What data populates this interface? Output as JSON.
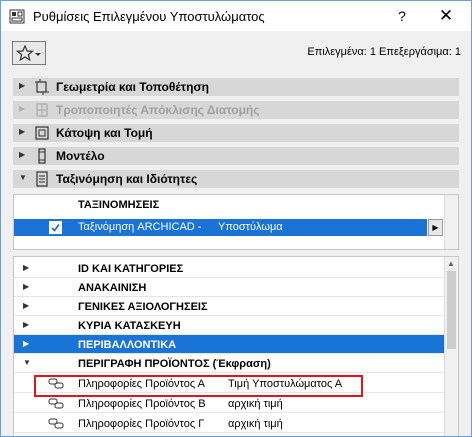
{
  "window": {
    "title": "Ρυθμίσεις Επιλεγμένου Υποστυλώματος",
    "help_label": "?",
    "close_label": "✕"
  },
  "toolbar": {
    "favorites_icon": "star-icon",
    "status_text": "Επιλεγμένα: 1 Επεξεργάσιμα: 1"
  },
  "panels": [
    {
      "label": "Γεωμετρία και Τοποθέτηση",
      "icon": "geometry-icon",
      "enabled": true,
      "expanded": false
    },
    {
      "label": "Τροποποιητές Απόκλισης Διατομής",
      "icon": "profile-modifier-icon",
      "enabled": false,
      "expanded": false
    },
    {
      "label": "Κάτοψη και Τομή",
      "icon": "floorplan-icon",
      "enabled": true,
      "expanded": false
    },
    {
      "label": "Μοντέλο",
      "icon": "model-icon",
      "enabled": true,
      "expanded": false
    },
    {
      "label": "Ταξινόμηση και Ιδιότητες",
      "icon": "classification-icon",
      "enabled": true,
      "expanded": true
    }
  ],
  "classifications": {
    "header": "ΤΑΞΙΝΟΜΗΣΕΙΣ",
    "row": {
      "system": "Ταξινόμηση ARCHICAD -",
      "value": "Υποστύλωμα",
      "checked": true
    }
  },
  "property_groups": [
    {
      "label": "ID ΚΑΙ ΚΑΤΗΓΟΡΙΕΣ",
      "expanded": false,
      "selected": false
    },
    {
      "label": "ΑΝΑΚΑΙΝΙΣΗ",
      "expanded": false,
      "selected": false
    },
    {
      "label": "ΓΕΝΙΚΕΣ ΑΞΙΟΛΟΓΗΣΕΙΣ",
      "expanded": false,
      "selected": false
    },
    {
      "label": "ΚΥΡΙΑ ΚΑΤΑΣΚΕΥΗ",
      "expanded": false,
      "selected": false
    },
    {
      "label": "ΠΕΡΙΒΑΛΛΟΝΤΙΚΑ",
      "expanded": false,
      "selected": true
    },
    {
      "label": "ΠΕΡΙΓΡΑΦΗ ΠΡΟΪΟΝΤΟΣ (Έκφραση)",
      "expanded": true,
      "selected": false
    }
  ],
  "properties": [
    {
      "name": "Πληροφορίες Προϊόντος Α",
      "value": "Τιμή Υποστυλώματος Α",
      "highlighted": true
    },
    {
      "name": "Πληροφορίες Προϊόντος Β",
      "value": "αρχική τιμή",
      "highlighted": false
    },
    {
      "name": "Πληροφορίες Προϊόντος Γ",
      "value": "αρχική τιμή",
      "highlighted": false
    }
  ],
  "colors": {
    "selection": "#1a73d6",
    "panel_bg": "#d7d7d7",
    "highlight_border": "#e0161b"
  }
}
